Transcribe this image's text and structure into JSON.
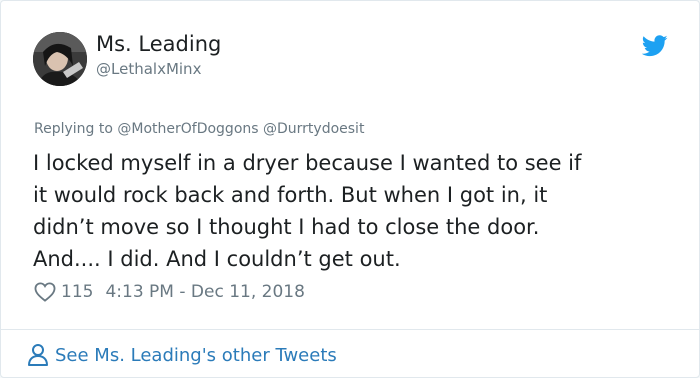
{
  "author": {
    "name": "Ms. Leading",
    "handle": "@LethalxMinx",
    "avatar_icon": "profile-photo"
  },
  "brand_icon": "twitter-bird-icon",
  "brand_color": "#1da1f2",
  "reply_context": "Replying to @MotherOfDoggons @Durrtydoesit",
  "tweet": {
    "lines": [
      "I locked myself in a dryer because I wanted to see if",
      "it would rock back and forth. But when I got in, it",
      "didn’t move so I thought I had to close the door.",
      "And.... I did. And I couldn’t get out."
    ]
  },
  "meta": {
    "like_icon": "heart-icon",
    "likes": "115",
    "timestamp": "4:13 PM - Dec 11, 2018"
  },
  "footer": {
    "icon": "person-icon",
    "link_text": "See Ms. Leading's other Tweets",
    "link_color": "#2b7bb9"
  }
}
